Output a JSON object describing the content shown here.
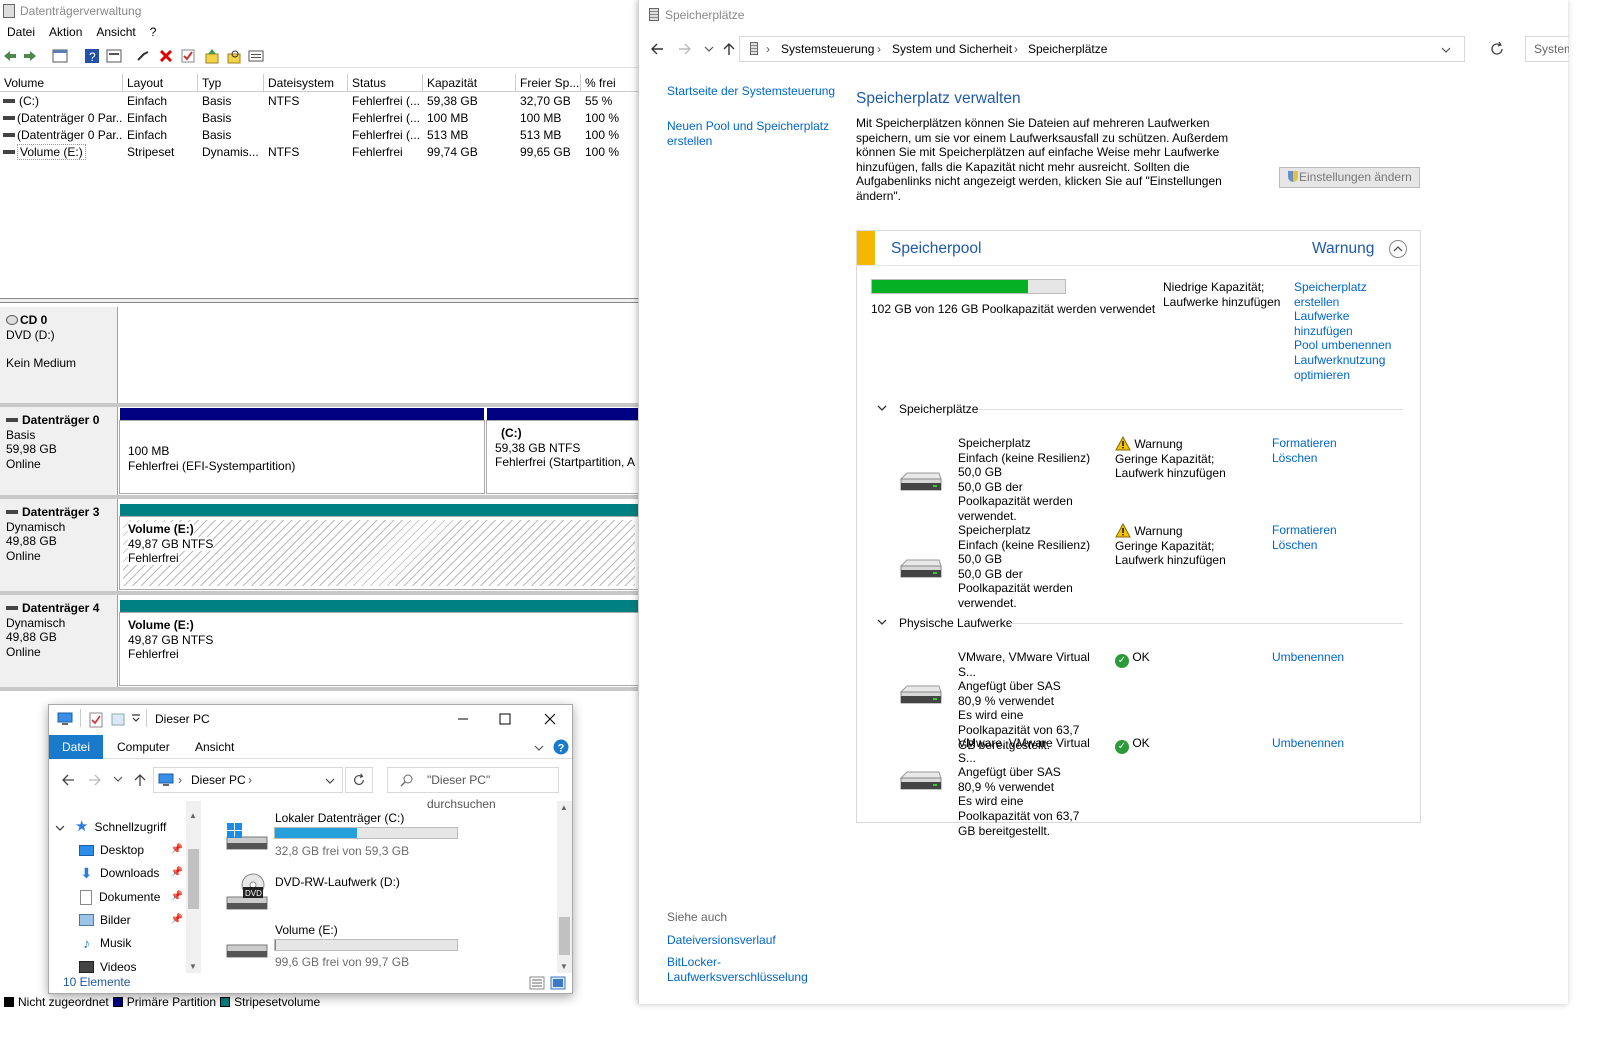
{
  "disk_mgmt": {
    "title": "Datenträgerverwaltung",
    "menu": [
      "Datei",
      "Aktion",
      "Ansicht",
      "?"
    ],
    "columns": [
      "Volume",
      "Layout",
      "Typ",
      "Dateisystem",
      "Status",
      "Kapazität",
      "Freier Sp...",
      "% frei"
    ],
    "volumes": [
      [
        "(C:)",
        "Einfach",
        "Basis",
        "NTFS",
        "Fehlerfrei (...",
        "59,38 GB",
        "32,70 GB",
        "55 %"
      ],
      [
        "(Datenträger 0 Par...",
        "Einfach",
        "Basis",
        "",
        "Fehlerfrei (...",
        "100 MB",
        "100 MB",
        "100 %"
      ],
      [
        "(Datenträger 0 Par...",
        "Einfach",
        "Basis",
        "",
        "Fehlerfrei (...",
        "513 MB",
        "513 MB",
        "100 %"
      ],
      [
        "Volume (E:)",
        "Stripeset",
        "Dynamis...",
        "NTFS",
        "Fehlerfrei",
        "99,74 GB",
        "99,65 GB",
        "100 %"
      ]
    ],
    "cd0": {
      "name": "CD 0",
      "line2": "DVD (D:)",
      "line3": "Kein Medium"
    },
    "disk0": {
      "name": "Datenträger 0",
      "type": "Basis",
      "size": "59,98 GB",
      "state": "Online",
      "p1_size": "100 MB",
      "p1_status": "Fehlerfrei (EFI-Systempartition)",
      "p2_name": "(C:)",
      "p2_size": "59,38 GB NTFS",
      "p2_status": "Fehlerfrei (Startpartition, Au"
    },
    "disk3": {
      "name": "Datenträger 3",
      "type": "Dynamisch",
      "size": "49,88 GB",
      "state": "Online",
      "v_name": "Volume  (E:)",
      "v_size": "49,87 GB NTFS",
      "v_status": "Fehlerfrei"
    },
    "disk4": {
      "name": "Datenträger 4",
      "type": "Dynamisch",
      "size": "49,88 GB",
      "state": "Online",
      "v_name": "Volume  (E:)",
      "v_size": "49,87 GB NTFS",
      "v_status": "Fehlerfrei"
    },
    "legend": [
      {
        "label": "Nicht zugeordnet",
        "color": "#000000"
      },
      {
        "label": "Primäre Partition",
        "color": "#000080"
      },
      {
        "label": "Stripesetvolume",
        "color": "#008080"
      }
    ]
  },
  "storage": {
    "title": "Speicherplätze",
    "breadcrumb": [
      "Systemsteuerung",
      "System und Sicherheit",
      "Speicherplätze"
    ],
    "search_partial": "System",
    "side_links": [
      "Startseite der Systemsteuerung",
      "Neuen Pool und Speicherplatz erstellen"
    ],
    "heading": "Speicherplatz verwalten",
    "intro": "Mit Speicherplätzen können Sie Dateien auf mehreren Laufwerken speichern, um sie vor einem Laufwerksausfall zu schützen. Außerdem können Sie mit Speicherplätzen auf einfache Weise mehr Laufwerke hinzufügen, falls die Kapazität nicht mehr ausreicht. Sollten die Aufgabenlinks nicht angezeigt werden, klicken Sie auf \"Einstellungen ändern\".",
    "change_settings": "Einstellungen ändern",
    "pool": {
      "title": "Speicherpool",
      "state": "Warnung",
      "used_text": "102 GB von 126 GB Poolkapazität werden verwendet",
      "used_fraction": 0.81,
      "notice": "Niedrige Kapazität; Laufwerke hinzufügen",
      "tasks": [
        "Speicherplatz erstellen",
        "Laufwerke hinzufügen",
        "Pool umbenennen",
        "Laufwerknutzung optimieren"
      ]
    },
    "spaces_header": "Speicherplätze",
    "spaces": [
      {
        "name": "Speicherplatz",
        "layout": "Einfach (keine Resilienz)",
        "size": "50,0 GB",
        "usage": "50,0 GB der Poolkapazität werden verwendet.",
        "status": "Warnung",
        "status_detail": "Geringe Kapazität; Laufwerk hinzufügen",
        "actions": [
          "Formatieren",
          "Löschen"
        ]
      },
      {
        "name": "Speicherplatz",
        "layout": "Einfach (keine Resilienz)",
        "size": "50,0 GB",
        "usage": "50,0 GB der Poolkapazität werden verwendet.",
        "status": "Warnung",
        "status_detail": "Geringe Kapazität; Laufwerk hinzufügen",
        "actions": [
          "Formatieren",
          "Löschen"
        ]
      }
    ],
    "phys_header": "Physische Laufwerke",
    "physical": [
      {
        "name": "VMware, VMware Virtual S...",
        "bus": "Angefügt über SAS",
        "used": "80,9 % verwendet",
        "contrib": "Es wird eine Poolkapazität von 63,7 GB bereitgestellt.",
        "status": "OK",
        "action": "Umbenennen"
      },
      {
        "name": "VMware, VMware Virtual S...",
        "bus": "Angefügt über SAS",
        "used": "80,9 % verwendet",
        "contrib": "Es wird eine Poolkapazität von 63,7 GB bereitgestellt.",
        "status": "OK",
        "action": "Umbenennen"
      }
    ],
    "see_also": "Siehe auch",
    "see_links": [
      "Dateiversionsverlauf",
      "BitLocker-Laufwerksverschlüsselung"
    ]
  },
  "explorer": {
    "title": "Dieser PC",
    "tabs": [
      "Datei",
      "Computer",
      "Ansicht"
    ],
    "address": "Dieser PC",
    "search_placeholder": "\"Dieser PC\" durchsuchen",
    "nav": [
      {
        "label": "Schnellzugriff"
      },
      {
        "label": "Desktop"
      },
      {
        "label": "Downloads"
      },
      {
        "label": "Dokumente"
      },
      {
        "label": "Bilder"
      },
      {
        "label": "Musik"
      },
      {
        "label": "Videos"
      }
    ],
    "drives": [
      {
        "name": "Lokaler Datenträger (C:)",
        "free": "32,8 GB frei von 59,3 GB",
        "used_fraction": 0.45
      },
      {
        "name": "DVD-RW-Laufwerk (D:)",
        "free": ""
      },
      {
        "name": "Volume (E:)",
        "free": "99,6 GB frei von 99,7 GB",
        "used_fraction": 0.001
      }
    ],
    "status": "10 Elemente"
  }
}
